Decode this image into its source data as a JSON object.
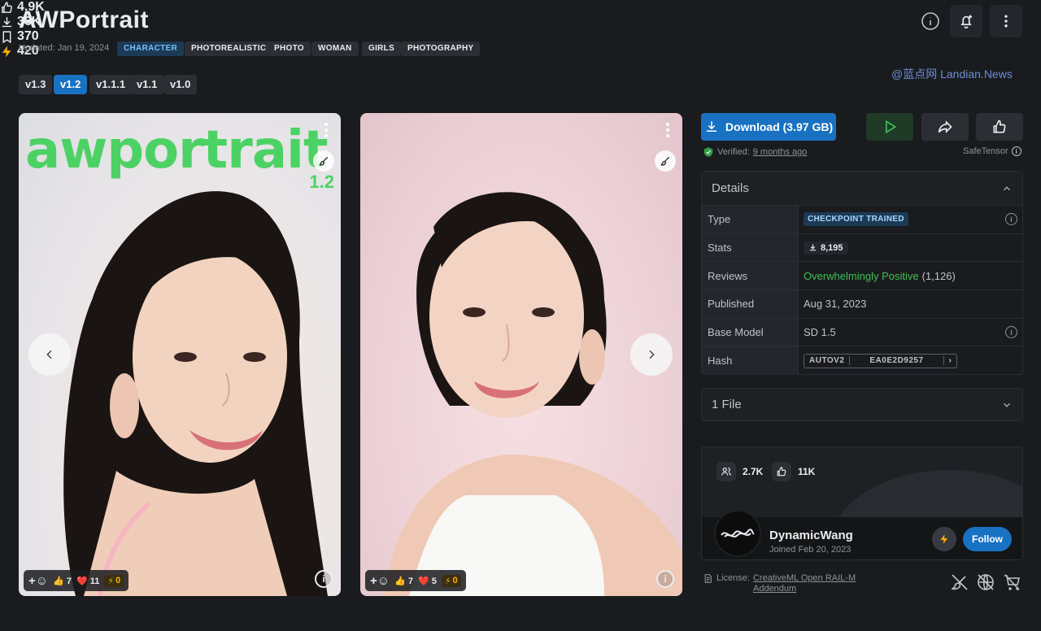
{
  "header": {
    "title": "AWPortrait",
    "stats": {
      "likes": "4.9K",
      "downloads": "36K",
      "bookmarks": "370",
      "buzz": "420"
    },
    "updated": "Updated: Jan 19, 2024",
    "tags": [
      "CHARACTER",
      "PHOTOREALISTIC",
      "PHOTO",
      "WOMAN",
      "GIRLS",
      "PHOTOGRAPHY"
    ],
    "versions": [
      "v1.3",
      "v1.2",
      "v1.1.1",
      "v1.1",
      "v1.0"
    ],
    "selected_version": "v1.2",
    "watermark": "@蓝点网 Landian.News"
  },
  "gallery": {
    "images": [
      {
        "overlay_title": "awportrait",
        "overlay_version": "1.2",
        "reactions": {
          "like": "7",
          "heart": "11",
          "buzz": "0"
        }
      },
      {
        "reactions": {
          "like": "7",
          "heart": "5",
          "buzz": "0"
        }
      }
    ]
  },
  "actions": {
    "download_label": "Download (3.97 GB)",
    "verified_label": "Verified:",
    "verified_time": "9 months ago",
    "safetensor": "SafeTensor"
  },
  "details": {
    "heading": "Details",
    "rows": {
      "type_key": "Type",
      "type_value": "CHECKPOINT TRAINED",
      "stats_key": "Stats",
      "stats_value": "8,195",
      "reviews_key": "Reviews",
      "reviews_value": "Overwhelmingly Positive",
      "reviews_count": "(1,126)",
      "published_key": "Published",
      "published_value": "Aug 31, 2023",
      "base_key": "Base Model",
      "base_value": "SD 1.5",
      "hash_key": "Hash",
      "hash_type": "AUTOV2",
      "hash_value": "EA0E2D9257"
    }
  },
  "files": {
    "label": "1 File"
  },
  "creator": {
    "followers": "2.7K",
    "likes": "11K",
    "name": "DynamicWang",
    "joined": "Joined Feb 20, 2023",
    "follow_label": "Follow"
  },
  "license": {
    "prefix": "License:",
    "name_line1": "CreativeML Open RAIL-M",
    "name_line2": "Addendum"
  },
  "colors": {
    "accent": "#1971c2",
    "buzz": "#fab005",
    "positive": "#40c057",
    "background": "#1a1b1e"
  }
}
